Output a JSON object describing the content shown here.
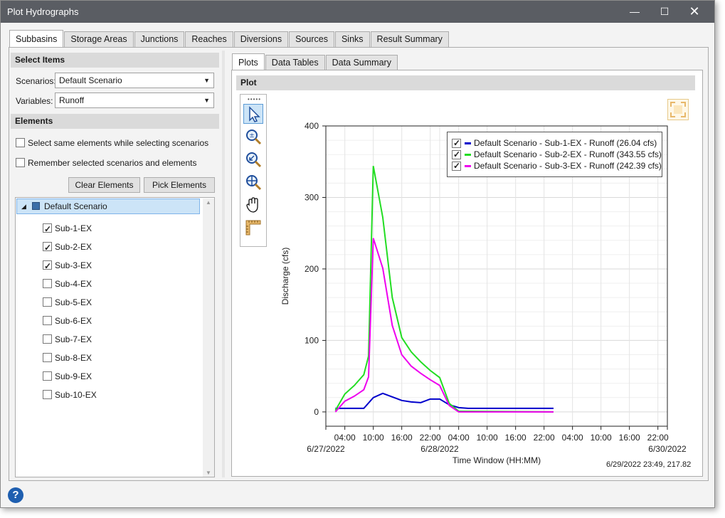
{
  "window": {
    "title": "Plot Hydrographs"
  },
  "main_tabs": [
    {
      "label": "Subbasins"
    },
    {
      "label": "Storage Areas"
    },
    {
      "label": "Junctions"
    },
    {
      "label": "Reaches"
    },
    {
      "label": "Diversions"
    },
    {
      "label": "Sources"
    },
    {
      "label": "Sinks"
    },
    {
      "label": "Result Summary"
    }
  ],
  "left": {
    "select_items_header": "Select Items",
    "scenarios_label": "Scenarios:",
    "scenarios_value": "Default Scenario",
    "variables_label": "Variables:",
    "variables_value": "Runoff",
    "elements_header": "Elements",
    "option1": "Select same elements while selecting scenarios",
    "option2": "Remember selected scenarios and elements",
    "clear_button": "Clear Elements",
    "pick_button": "Pick Elements",
    "tree_root": "Default Scenario",
    "tree_items": [
      {
        "label": "Sub-1-EX",
        "checked": true
      },
      {
        "label": "Sub-2-EX",
        "checked": true
      },
      {
        "label": "Sub-3-EX",
        "checked": true
      },
      {
        "label": "Sub-4-EX",
        "checked": false
      },
      {
        "label": "Sub-5-EX",
        "checked": false
      },
      {
        "label": "Sub-6-EX",
        "checked": false
      },
      {
        "label": "Sub-7-EX",
        "checked": false
      },
      {
        "label": "Sub-8-EX",
        "checked": false
      },
      {
        "label": "Sub-9-EX",
        "checked": false
      },
      {
        "label": "Sub-10-EX",
        "checked": false
      }
    ]
  },
  "right": {
    "tabs": [
      {
        "label": "Plots"
      },
      {
        "label": "Data Tables"
      },
      {
        "label": "Data Summary"
      }
    ],
    "plot_header": "Plot",
    "tools": [
      "pointer-icon",
      "zoom-in-out-icon",
      "zoom-back-icon",
      "zoom-extents-icon",
      "pan-hand-icon",
      "ruler-icon"
    ],
    "coords_readout": "6/29/2022 23:49, 217.82"
  },
  "chart_data": {
    "type": "line",
    "ylabel": "Discharge (cfs)",
    "xlabel": "Time Window (HH:MM)",
    "ylim": [
      -20,
      400
    ],
    "xlim_hours": [
      0,
      72
    ],
    "yticks": [
      0,
      100,
      200,
      300,
      400
    ],
    "xticks": [
      {
        "h": 0,
        "label": "",
        "date": "6/27/2022"
      },
      {
        "h": 4,
        "label": "04:00",
        "date": ""
      },
      {
        "h": 10,
        "label": "10:00",
        "date": ""
      },
      {
        "h": 16,
        "label": "16:00",
        "date": ""
      },
      {
        "h": 22,
        "label": "22:00",
        "date": ""
      },
      {
        "h": 24,
        "label": "",
        "date": "6/28/2022"
      },
      {
        "h": 28,
        "label": "04:00",
        "date": ""
      },
      {
        "h": 34,
        "label": "10:00",
        "date": ""
      },
      {
        "h": 40,
        "label": "16:00",
        "date": ""
      },
      {
        "h": 46,
        "label": "22:00",
        "date": ""
      },
      {
        "h": 48,
        "label": "",
        "date": "6/30/2022"
      }
    ],
    "grid": true,
    "legend_position": "top-right",
    "series": [
      {
        "name": "Default Scenario - Sub-1-EX - Runoff (26.04 cfs)",
        "color": "#0000cc",
        "x": [
          2,
          3,
          4,
          6,
          8,
          10,
          12,
          14,
          16,
          18,
          20,
          22,
          24,
          26,
          28,
          30,
          48
        ],
        "y": [
          5,
          5,
          5,
          5,
          5,
          20,
          26,
          21,
          16,
          14,
          13,
          18,
          18,
          10,
          6,
          5,
          5
        ]
      },
      {
        "name": "Default Scenario - Sub-2-EX - Runoff (343.55 cfs)",
        "color": "#22dd22",
        "x": [
          2,
          4,
          6,
          8,
          9,
          10,
          12,
          14,
          16,
          18,
          20,
          22,
          24,
          26,
          28,
          48
        ],
        "y": [
          2,
          25,
          37,
          52,
          78,
          344,
          272,
          160,
          104,
          84,
          70,
          58,
          48,
          12,
          1,
          0
        ]
      },
      {
        "name": "Default Scenario - Sub-3-EX - Runoff (242.39 cfs)",
        "color": "#ee00ee",
        "x": [
          2,
          4,
          6,
          8,
          9,
          10,
          12,
          14,
          16,
          18,
          20,
          22,
          24,
          26,
          28,
          48
        ],
        "y": [
          0,
          15,
          22,
          31,
          49,
          243,
          201,
          121,
          80,
          64,
          54,
          45,
          37,
          9,
          0,
          0
        ]
      }
    ]
  }
}
